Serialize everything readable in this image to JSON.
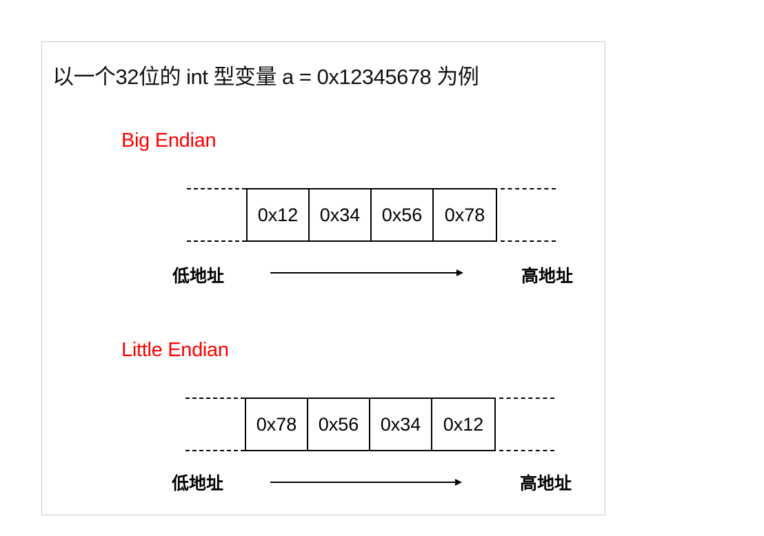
{
  "heading": "以一个32位的 int 型变量 a = 0x12345678 为例",
  "accent_color": "#ff0000",
  "big_endian": {
    "title": "Big Endian",
    "cells": [
      "0x12",
      "0x34",
      "0x56",
      "0x78"
    ],
    "low_address": "低地址",
    "high_address": "高地址"
  },
  "little_endian": {
    "title": "Little Endian",
    "cells": [
      "0x78",
      "0x56",
      "0x34",
      "0x12"
    ],
    "low_address": "低地址",
    "high_address": "高地址"
  }
}
